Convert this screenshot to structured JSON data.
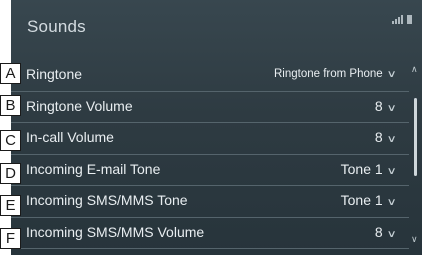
{
  "header": {
    "title": "Sounds"
  },
  "icons": {
    "signal": "signal-strength-icon",
    "battery": "battery-icon"
  },
  "rows": [
    {
      "callout": "A",
      "label": "Ringtone",
      "value": "Ringtone from Phone"
    },
    {
      "callout": "B",
      "label": "Ringtone Volume",
      "value": "8"
    },
    {
      "callout": "C",
      "label": "In-call Volume",
      "value": "8"
    },
    {
      "callout": "D",
      "label": "Incoming E-mail Tone",
      "value": "Tone 1"
    },
    {
      "callout": "E",
      "label": "Incoming SMS/MMS Tone",
      "value": "Tone 1"
    },
    {
      "callout": "F",
      "label": "Incoming SMS/MMS Volume",
      "value": "8"
    }
  ],
  "colors": {
    "background": "#2e3b42",
    "text": "#e9eef1",
    "divider": "#55646c"
  }
}
